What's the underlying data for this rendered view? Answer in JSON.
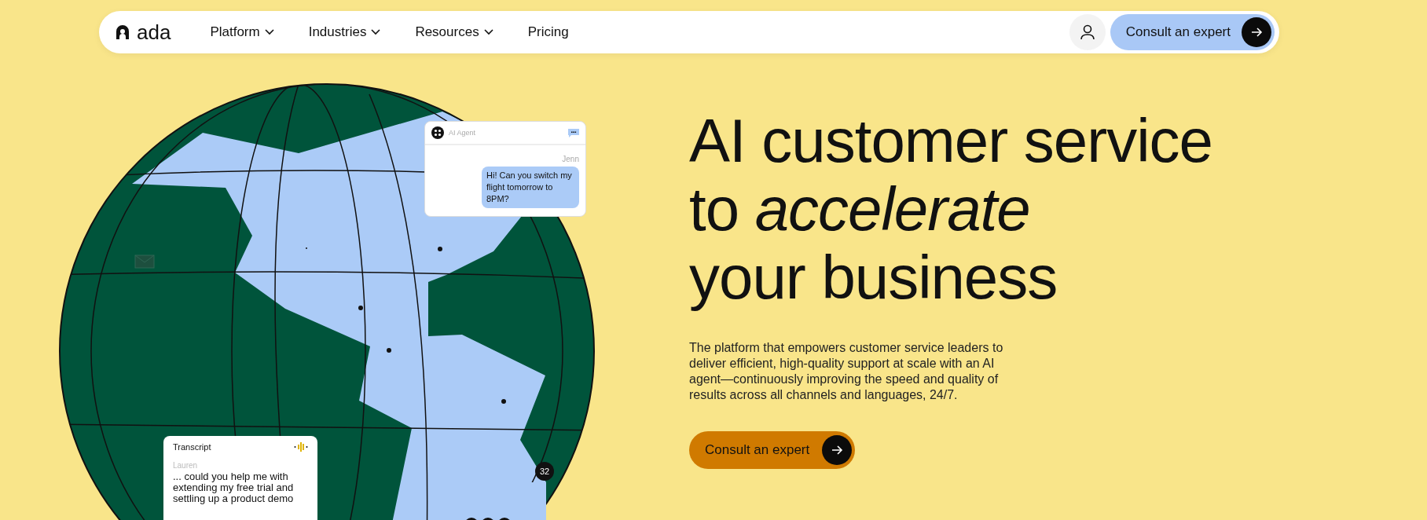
{
  "nav": {
    "logo": "ada",
    "items": [
      {
        "label": "Platform",
        "kind": "menu"
      },
      {
        "label": "Industries",
        "kind": "menu"
      },
      {
        "label": "Resources",
        "kind": "menu"
      },
      {
        "label": "Pricing",
        "kind": "link"
      }
    ],
    "cta": "Consult an expert"
  },
  "hero": {
    "headline": [
      "AI customer service",
      "to *accelerate*",
      "your business"
    ],
    "body": "The platform that empowers customer service leaders to deliver efficient, high-quality support at scale with an AI agent—continuously improving the speed and quality of results across all channels and languages, 24/7.",
    "cta": "Consult an expert"
  },
  "chat_card": {
    "title": "AI Agent",
    "sender": "Jenn",
    "message": "Hi! Can you switch my flight tomorrow to 8PM?"
  },
  "transcript_card": {
    "title": "Transcript",
    "speaker": "Lauren",
    "text": "... could you help me with extending my free trial and settling up a product demo"
  },
  "badge": "32"
}
